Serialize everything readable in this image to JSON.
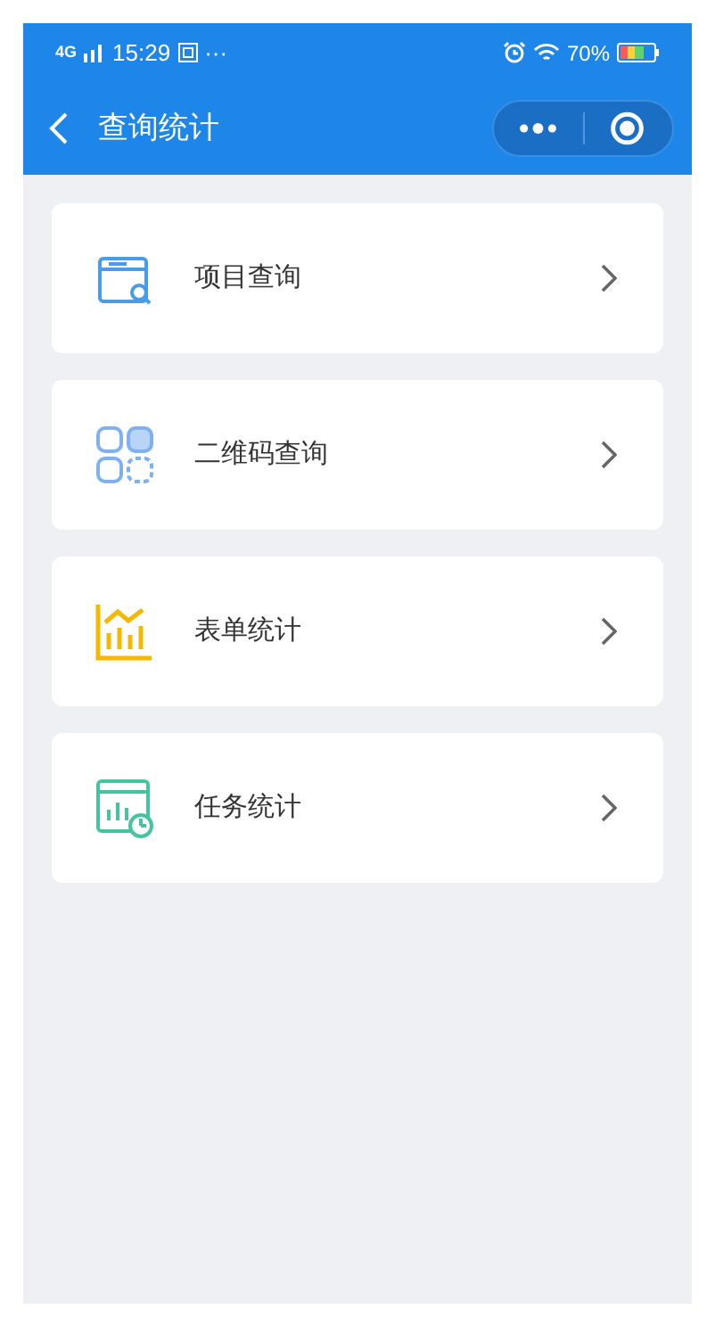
{
  "status_bar": {
    "network": "4G",
    "time": "15:29",
    "more": "···",
    "battery": "70%"
  },
  "nav": {
    "title": "查询统计"
  },
  "items": [
    {
      "kind": "project",
      "label": "项目查询"
    },
    {
      "kind": "qrcode",
      "label": "二维码查询"
    },
    {
      "kind": "form",
      "label": "表单统计"
    },
    {
      "kind": "task",
      "label": "任务统计"
    }
  ]
}
